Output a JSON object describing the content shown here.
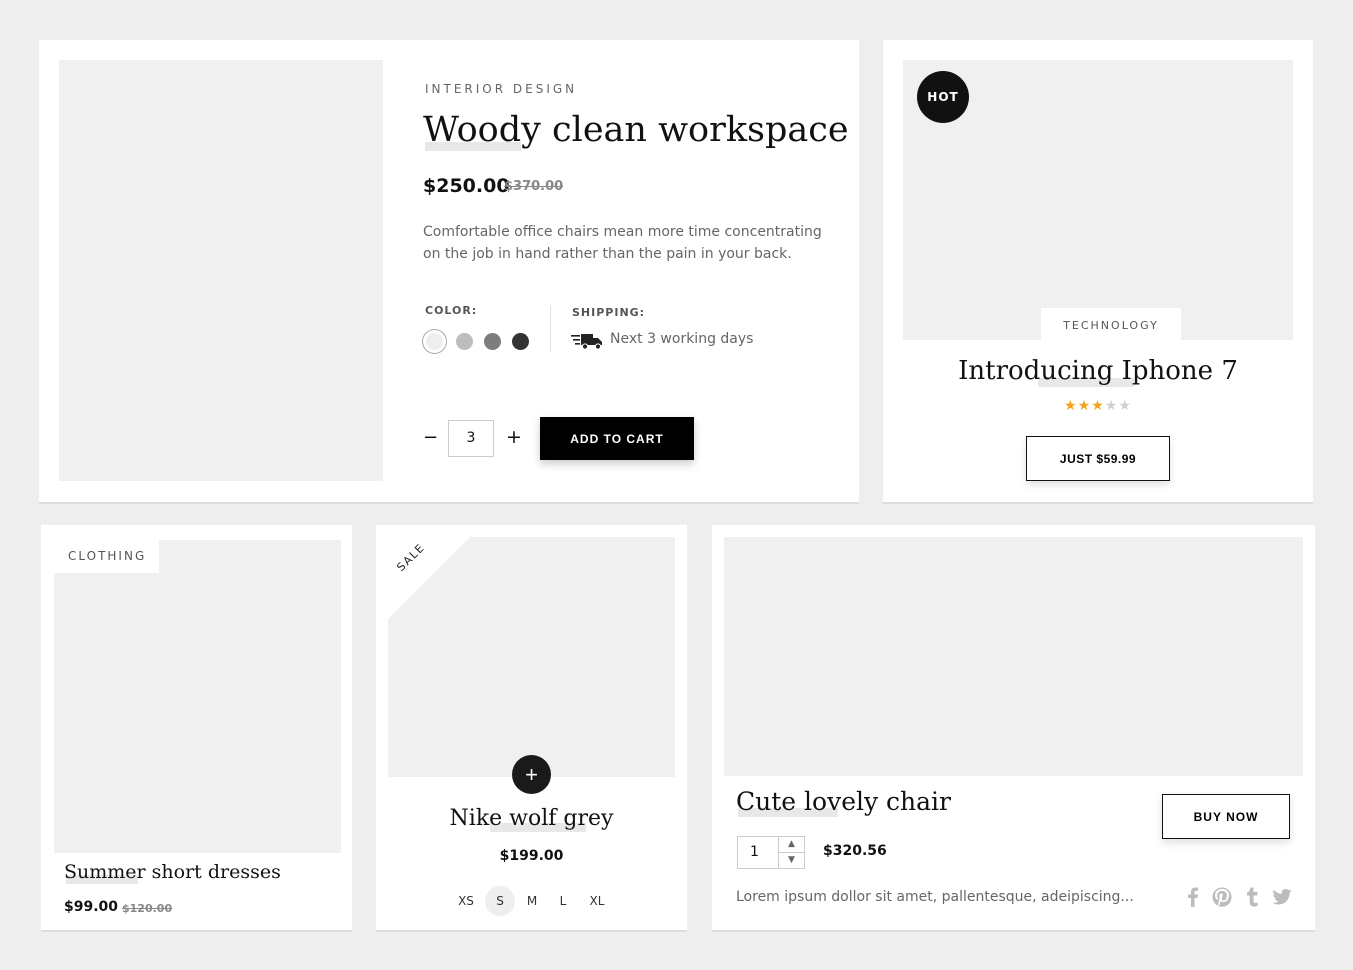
{
  "featured": {
    "category": "INTERIOR DESIGN",
    "title": "Woody clean workspace",
    "price": "$250.00",
    "old_price": "$370.00",
    "description": "Comfortable office chairs mean more time concentrating on the job in hand rather than the pain in your back.",
    "color_label": "COLOR:",
    "colors": [
      "#eeeeee",
      "#bdbdbd",
      "#7d7d7d",
      "#333333"
    ],
    "shipping_label": "SHIPPING:",
    "shipping_text": "Next 3 working days",
    "quantity": "3",
    "minus": "−",
    "plus": "+",
    "add_to_cart": "ADD TO CART"
  },
  "iphone": {
    "badge": "HOT",
    "category": "TECHNOLOGY",
    "title": "Introducing Iphone 7",
    "rating": 3,
    "rating_max": 5,
    "button": "JUST $59.99"
  },
  "dresses": {
    "category": "CLOTHING",
    "title": "Summer short dresses",
    "price": "$99.00",
    "old_price": "$120.00"
  },
  "nike": {
    "badge": "SALE",
    "add": "+",
    "title": "Nike wolf grey",
    "price": "$199.00",
    "sizes": [
      "XS",
      "S",
      "M",
      "L",
      "XL"
    ],
    "selected_size": "S"
  },
  "chair": {
    "title": "Cute lovely chair",
    "quantity": "1",
    "price": "$320.56",
    "button": "BUY NOW",
    "description": "Lorem ipsum dollor sit amet, pallentesque, adeipiscing...",
    "social": [
      "facebook-icon",
      "pinterest-icon",
      "tumblr-icon",
      "twitter-icon"
    ]
  },
  "colors": {
    "accent_star": "#f2a51a",
    "placeholder": "#f0f0f0",
    "dark": "#111111"
  }
}
